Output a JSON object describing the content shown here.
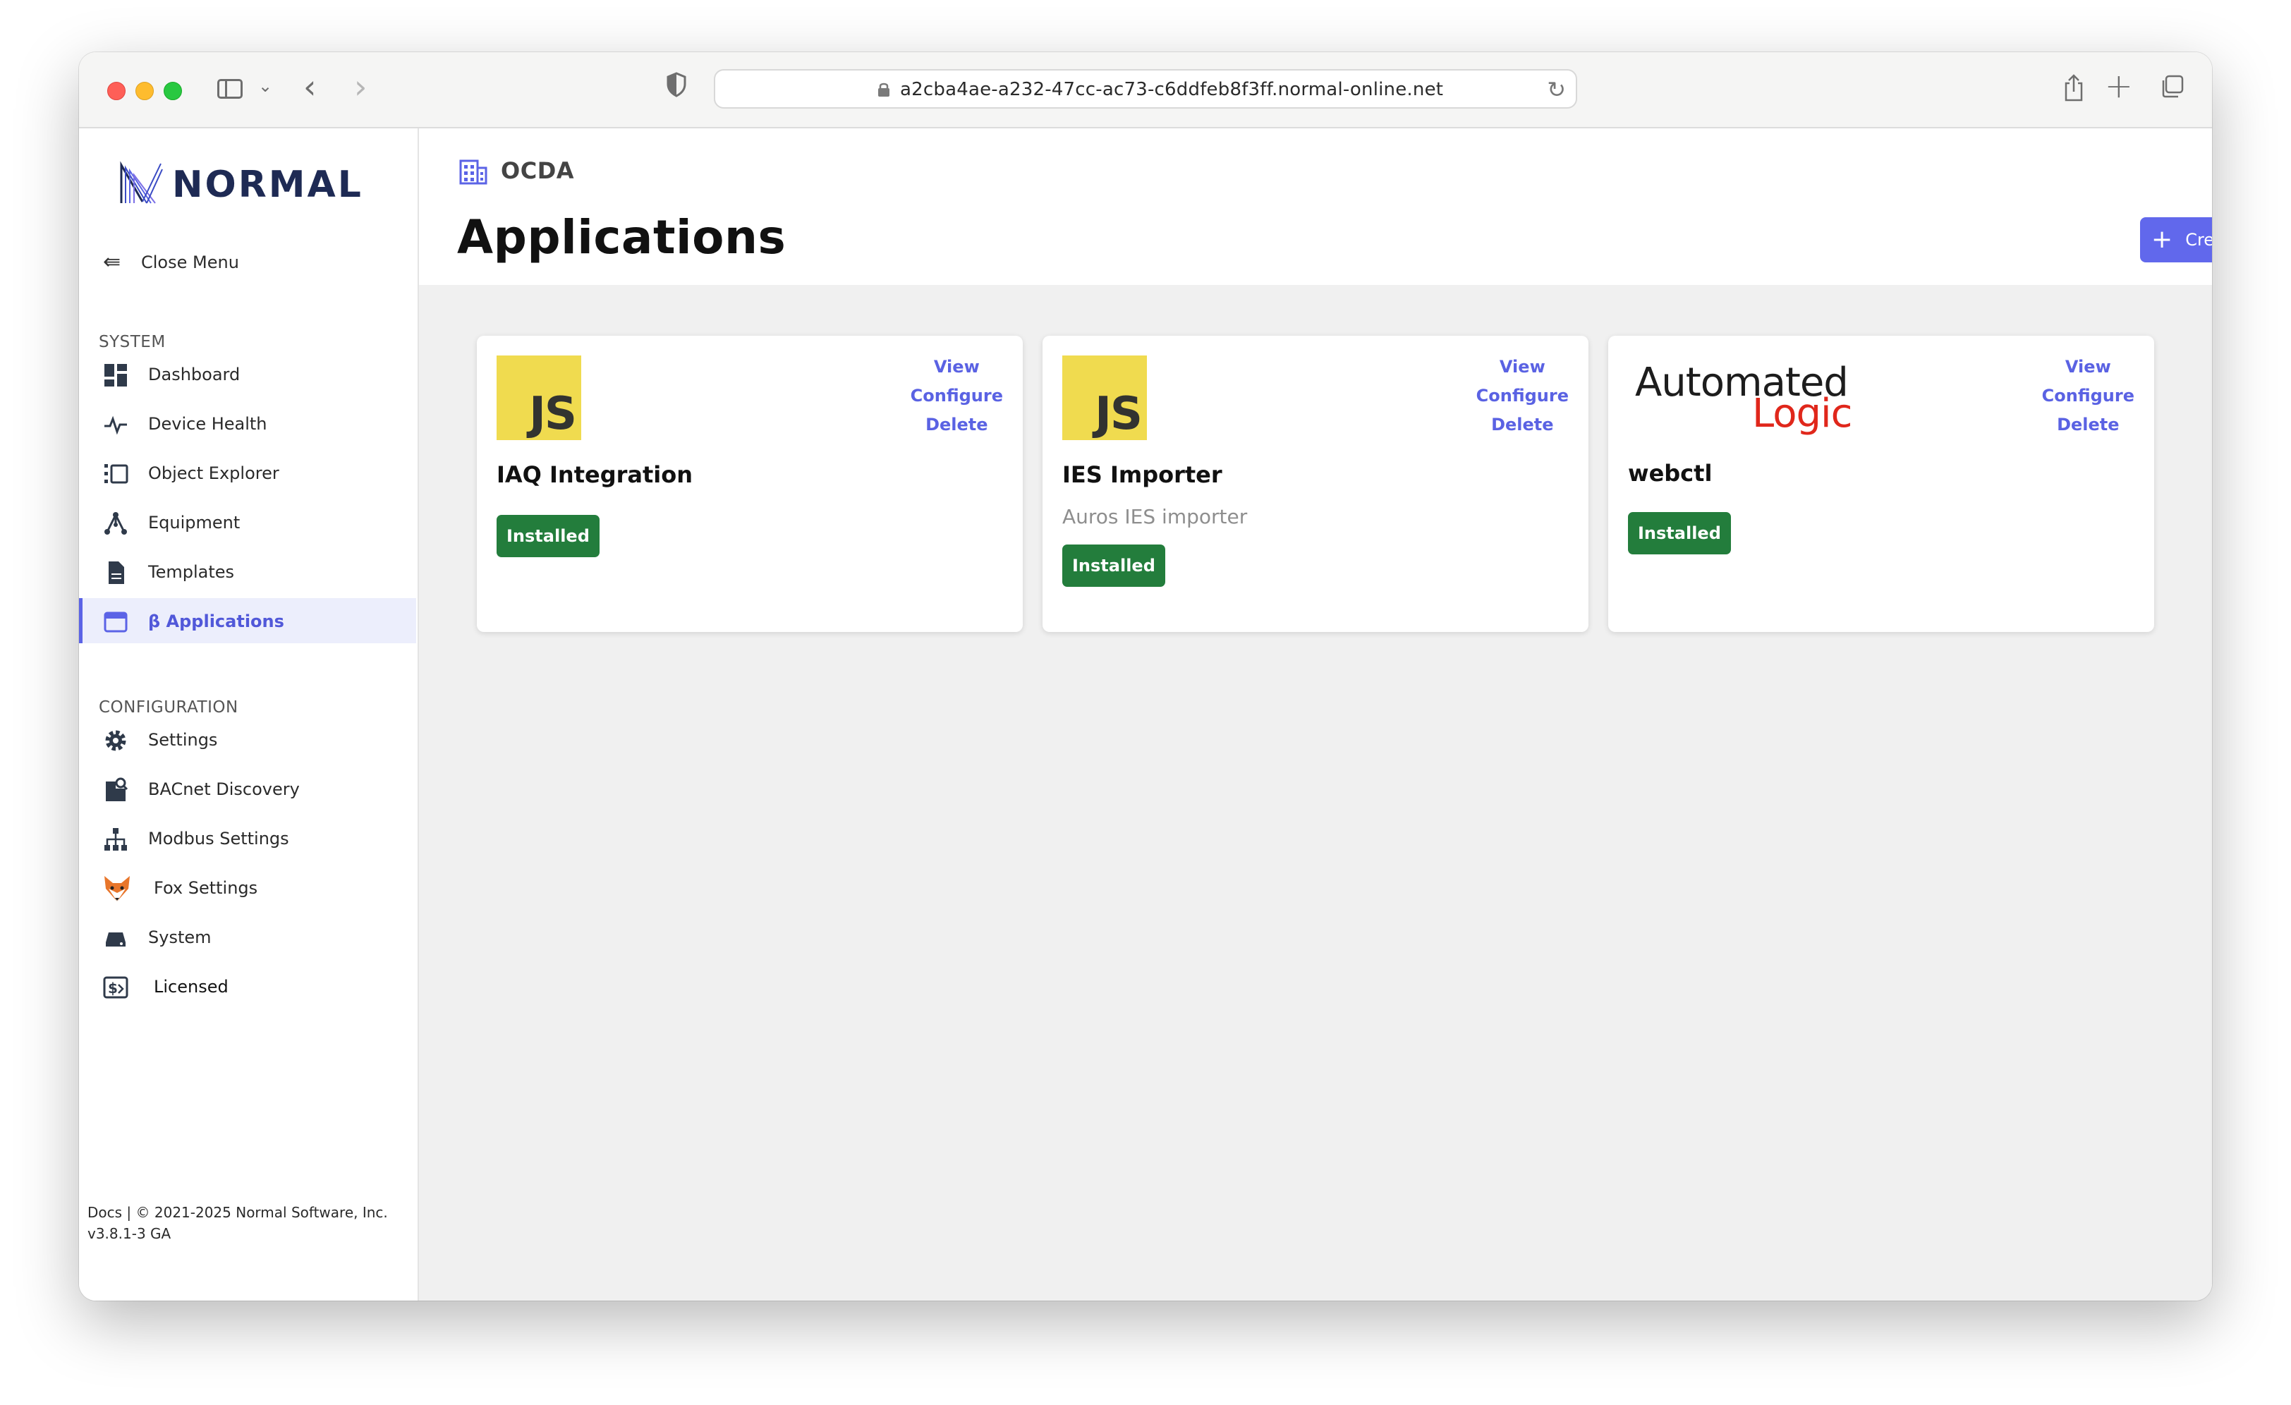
{
  "browser": {
    "url": "a2cba4ae-a232-47cc-ac73-c6ddfeb8f3ff.normal-online.net"
  },
  "sidebar": {
    "logo_text": "NORMAL",
    "close_menu_label": "Close Menu",
    "system_title": "SYSTEM",
    "system_items": [
      {
        "label": "Dashboard",
        "icon": "dashboard-icon"
      },
      {
        "label": "Device Health",
        "icon": "heartbeat-icon"
      },
      {
        "label": "Object Explorer",
        "icon": "object-explorer-icon"
      },
      {
        "label": "Equipment",
        "icon": "equipment-icon"
      },
      {
        "label": "Templates",
        "icon": "document-icon"
      },
      {
        "label": "β Applications",
        "icon": "browser-window-icon",
        "active": true
      }
    ],
    "configuration_title": "CONFIGURATION",
    "configuration_items": [
      {
        "label": "Settings",
        "icon": "gear-icon"
      },
      {
        "label": "BACnet Discovery",
        "icon": "bacnet-discovery-icon"
      },
      {
        "label": "Modbus Settings",
        "icon": "network-tree-icon"
      },
      {
        "label": "Fox Settings",
        "icon": "fox-icon"
      },
      {
        "label": "System",
        "icon": "hard-drive-icon"
      },
      {
        "label": "Licensed",
        "icon": "license-icon"
      }
    ],
    "footer_line1": "Docs | © 2021-2025 Normal Software, Inc.",
    "footer_line2": "v3.8.1-3 GA"
  },
  "header": {
    "breadcrumb": "OCDA",
    "title": "Applications",
    "create_label": "Create"
  },
  "cards": [
    {
      "name": "IAQ Integration",
      "logo": "JS",
      "description": "",
      "status": "Installed",
      "actions": [
        "View",
        "Configure",
        "Delete"
      ]
    },
    {
      "name": "IES Importer",
      "logo": "JS",
      "description": "Auros IES importer",
      "status": "Installed",
      "actions": [
        "View",
        "Configure",
        "Delete"
      ]
    },
    {
      "name": "webctl",
      "logo_line1": "Automated",
      "logo_line2": "Logic",
      "description": "",
      "status": "Installed",
      "actions": [
        "View",
        "Configure",
        "Delete"
      ]
    }
  ],
  "colors": {
    "accent": "#6168ec",
    "installed_badge": "#237d3c",
    "js_yellow": "#f0db4f",
    "logo_navy": "#1e2a54"
  }
}
